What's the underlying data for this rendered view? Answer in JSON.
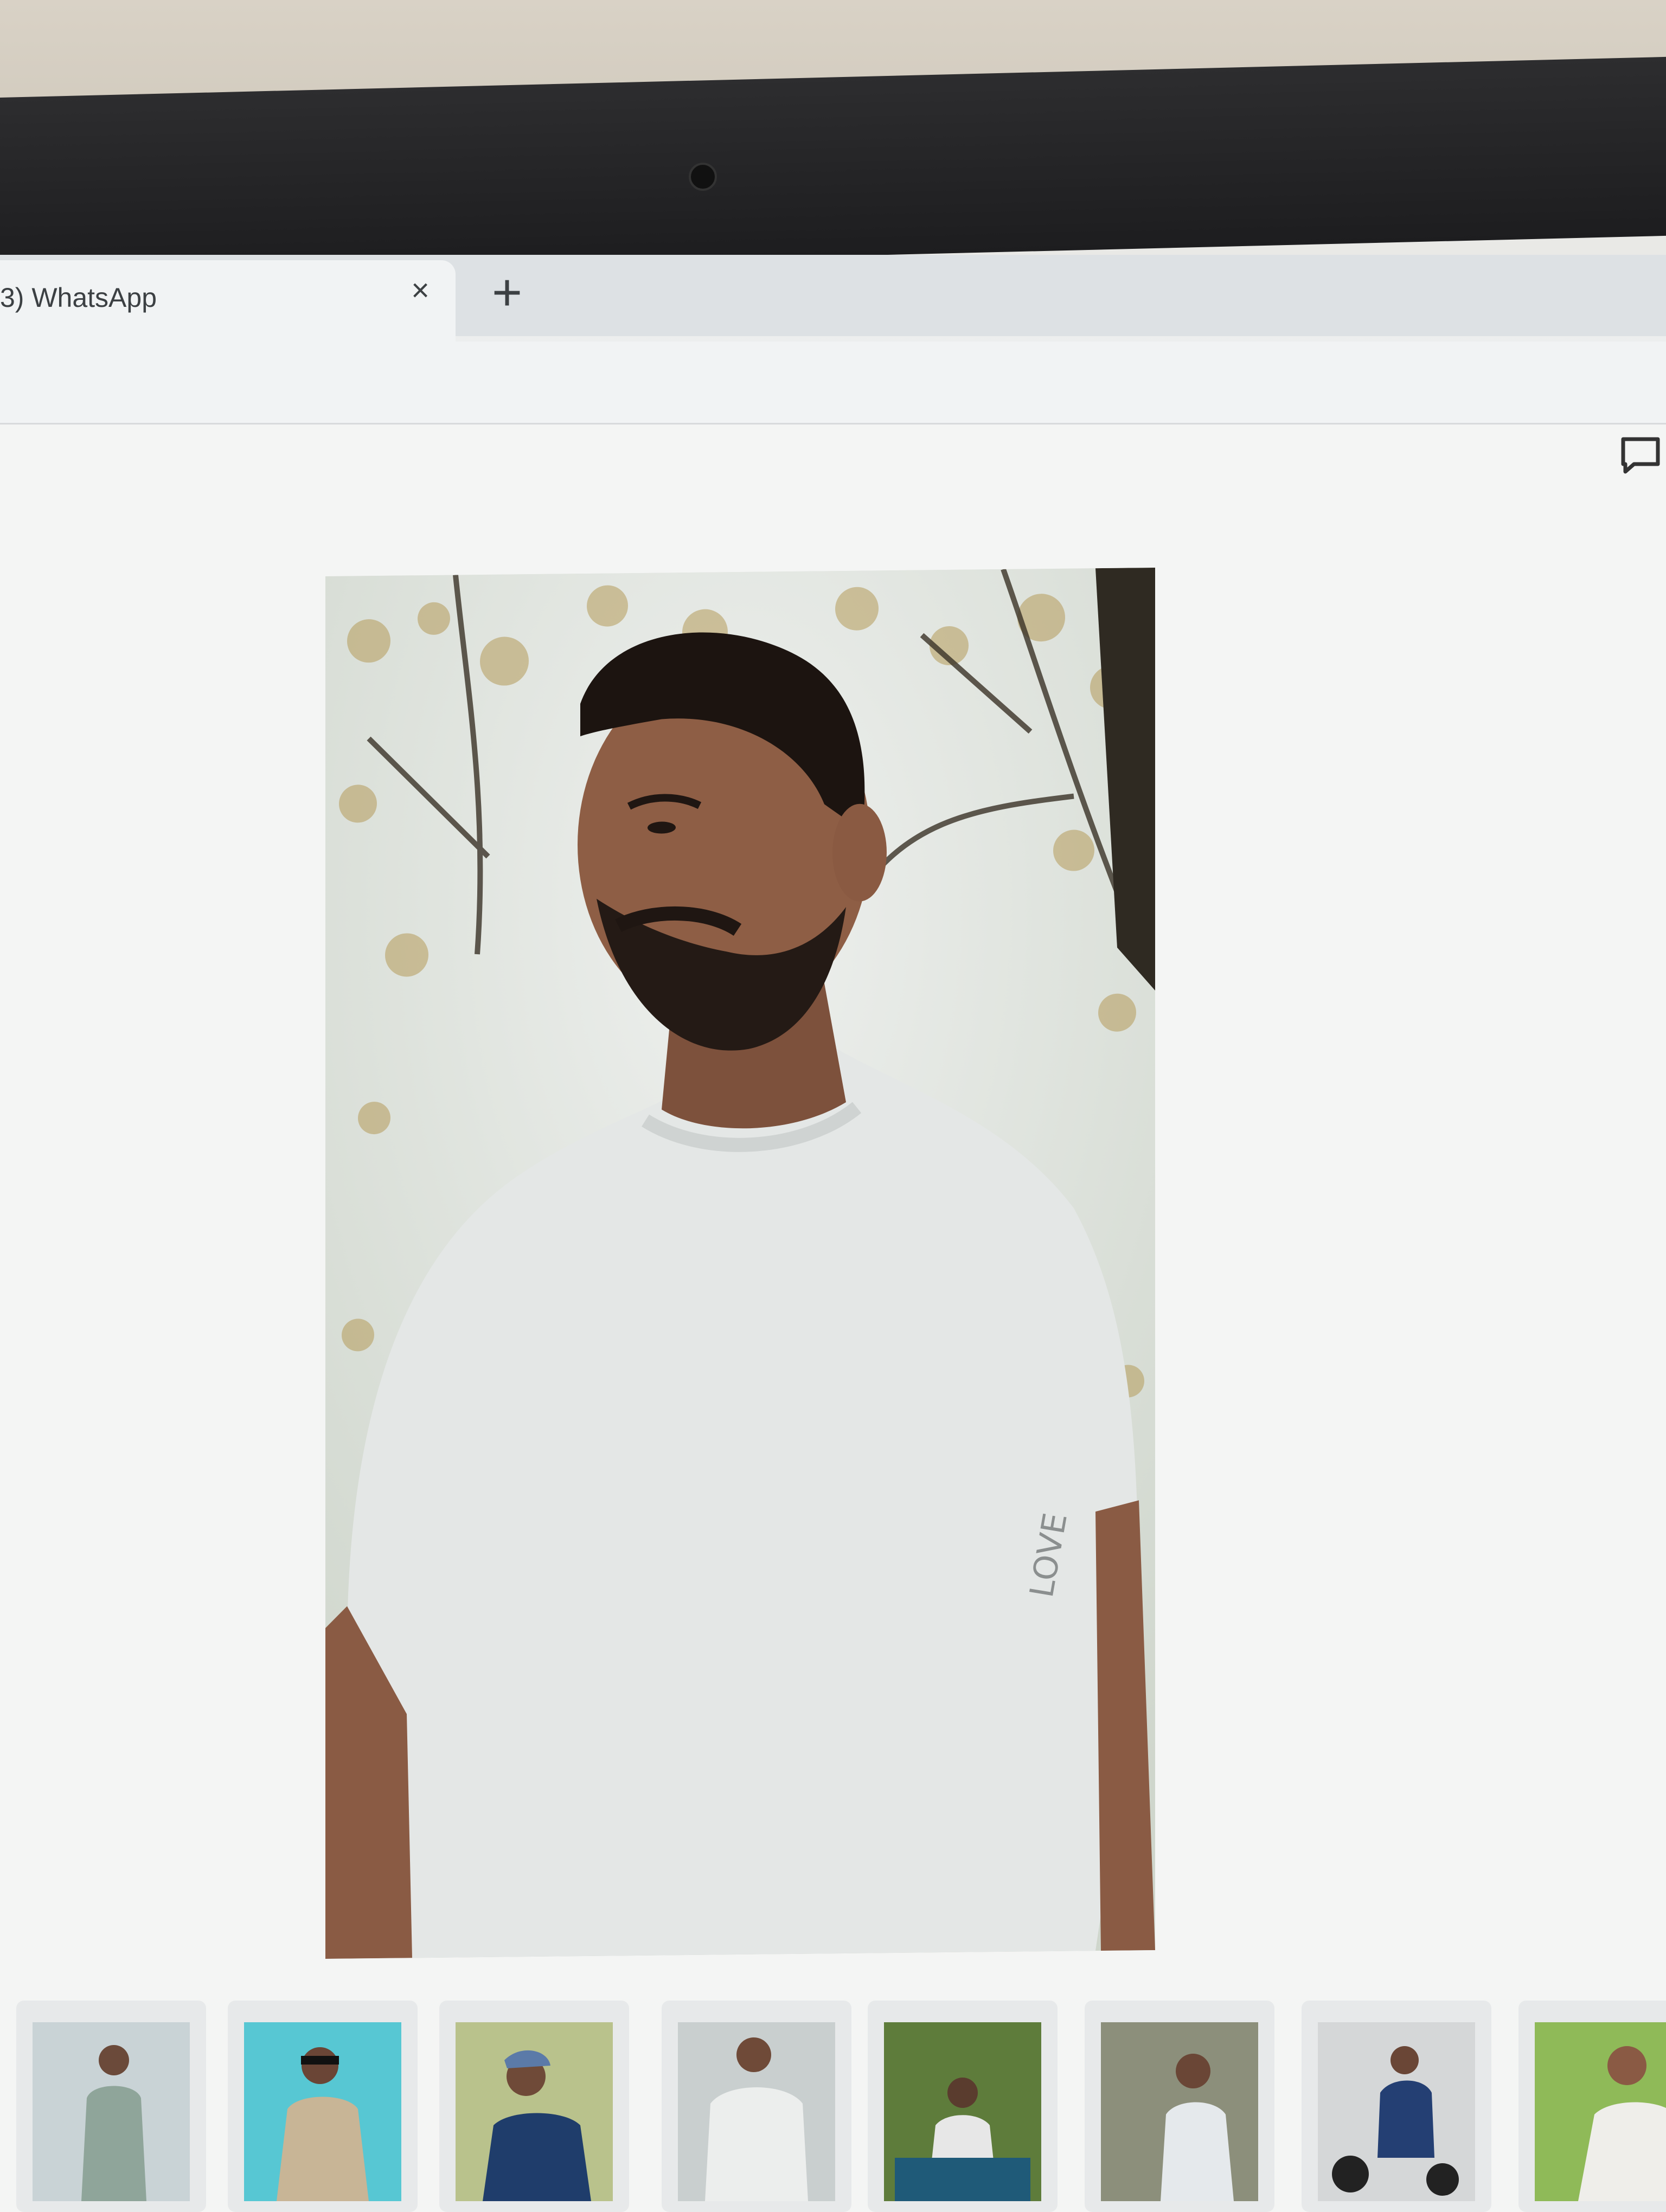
{
  "browser": {
    "tab_title": "3) WhatsApp",
    "tab_close": "×",
    "new_tab": "+"
  },
  "viewer": {
    "main_photo_icon": "person-photo",
    "chat_icon": "message-square-icon"
  },
  "thumbnails": [
    {
      "icon": "person-photo",
      "bg": "#c9d3d6"
    },
    {
      "icon": "person-photo",
      "bg": "#57c7d3"
    },
    {
      "icon": "person-photo",
      "bg": "#b9c28c"
    },
    {
      "icon": "person-photo",
      "bg": "#c9cfcf"
    },
    {
      "icon": "person-photo",
      "bg": "#5e7c3b"
    },
    {
      "icon": "person-photo",
      "bg": "#8c8f7b"
    },
    {
      "icon": "person-photo",
      "bg": "#d5d7d8"
    },
    {
      "icon": "person-photo",
      "bg": "#8fba58"
    }
  ],
  "colors": {
    "tab_bg": "#f1f3f4",
    "tabstrip_bg": "#dde1e4",
    "bezel": "#1d1d1f"
  }
}
